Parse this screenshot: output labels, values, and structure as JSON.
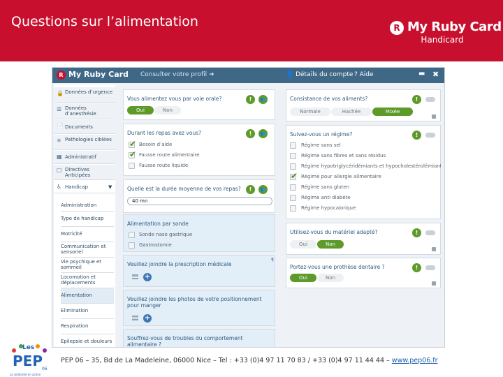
{
  "slide": {
    "title": "Questions sur l’alimentation",
    "footer": "PEP 06 – 35, Bd de La Madeleine, 06000 Nice – Tel : +33 (0)4 97 11 70 83 / +33 (0)4 97 11 44 44 – ",
    "footer_link": "www.pep06.fr"
  },
  "brand": {
    "name": "My Ruby Card",
    "sub": "Handicard",
    "gem_letter": "R"
  },
  "pep_logo": {
    "top": "Les",
    "letters": "PEP",
    "num": "06",
    "tagline": "La solidarité en action"
  },
  "colors": {
    "banner": "#c8102e",
    "topbar": "#3f6786",
    "accent_green": "#5e9a2a",
    "plus_blue": "#3f77b3"
  },
  "app": {
    "logo": "My Ruby Card",
    "logo_letter": "R",
    "profile_link": "Consulter votre profil ➜",
    "account_link": "👤 Détails du compte",
    "help_link": "? Aide",
    "min_icon": "▬",
    "close_icon": "✖"
  },
  "sidebar": {
    "items": [
      {
        "icon": "🔒",
        "label": "Données d’urgence"
      },
      {
        "icon": "☰",
        "label": "Données d’anesthésie"
      },
      {
        "icon": "📄",
        "label": "Documents"
      },
      {
        "icon": "✳",
        "label": "Pathologies ciblées"
      },
      {
        "icon": "▦",
        "label": "Administratif"
      },
      {
        "icon": "☐",
        "label": "Directives Anticipées"
      },
      {
        "icon": "♿",
        "label": "Handicap",
        "caret": "▼"
      }
    ],
    "subitems": [
      "Administration",
      "Type de handicap",
      "Motricité",
      "Communication et sensoriel",
      "Vie psychique et sommeil",
      "Locomotion et déplacements",
      "Alimentation",
      "Elimination",
      "Respiration",
      "Epilepsie et douleurs"
    ]
  },
  "icons": {
    "alert": "!",
    "group": "👥",
    "plus": "+",
    "attach": "¶"
  },
  "left_col": {
    "q1": {
      "question": "Vous alimentez vous par voie orale?",
      "options": [
        "Oui",
        "Non"
      ],
      "selected": "Oui"
    },
    "q2": {
      "question": "Durant les repas avez vous?",
      "options": [
        {
          "label": "Besoin d’aide",
          "checked": true
        },
        {
          "label": "Fausse route alimentaire",
          "checked": true
        },
        {
          "label": "Fausse route liquide",
          "checked": false
        }
      ]
    },
    "q3": {
      "question": "Quelle est la durée moyenne de vos repas?",
      "value": "40 mn"
    },
    "q4": {
      "question": "Alimentation par sonde",
      "options": [
        {
          "label": "Sonde naso gastrique",
          "checked": false
        },
        {
          "label": "Gastrostomie",
          "checked": false
        }
      ]
    },
    "q5": {
      "question": "Veuillez joindre la prescription médicale"
    },
    "q6": {
      "question": "Veuillez joindre les photos de votre positionnement pour manger"
    },
    "q7": {
      "question": "Souffrez-vous de troubles du comportement alimentaire ?"
    }
  },
  "right_col": {
    "q1": {
      "question": "Consistance de vos aliments?",
      "options": [
        "Normale",
        "Hachée",
        "Mixée"
      ],
      "selected": "Mixée"
    },
    "q2": {
      "question": "Suivez-vous un régime?",
      "options": [
        {
          "label": "Régime sans sel",
          "checked": false
        },
        {
          "label": "Régime sans fibres et sans résidus",
          "checked": false
        },
        {
          "label": "Régime hypotriglycéridémiants et hypocholestérolémiants",
          "checked": false
        },
        {
          "label": "Régime pour allergie alimentaire",
          "checked": true
        },
        {
          "label": "Régime sans gluten",
          "checked": false
        },
        {
          "label": "Régime anti diabète",
          "checked": false
        },
        {
          "label": "Régime hypocalorique",
          "checked": false
        }
      ]
    },
    "q3": {
      "question": "Utilisez-vous du matériel adapté?",
      "options": [
        "Oui",
        "Non"
      ],
      "selected": "Non"
    },
    "q4": {
      "question": "Portez-vous une prothèse dentaire ?",
      "options": [
        "Oui",
        "Non"
      ],
      "selected": "Oui"
    }
  }
}
